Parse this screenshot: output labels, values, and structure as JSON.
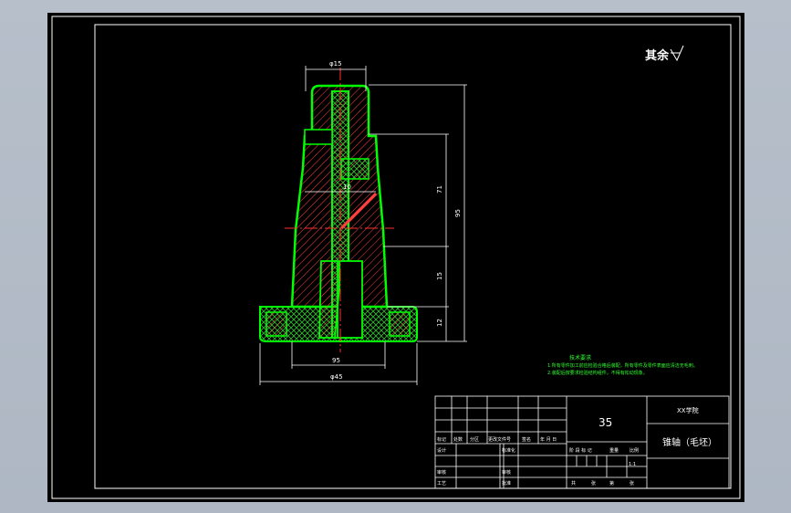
{
  "roughness_note": "其余",
  "dimensions": {
    "top_diameter": "φ15",
    "middle_diameter": "10",
    "bottom_inner": "95",
    "base_diameter": "φ45",
    "height_71": "71",
    "height_95": "95",
    "height_15": "15",
    "height_12": "12"
  },
  "tech_requirements": {
    "title": "技术要求",
    "line1": "1.所有零件加工前应检验合格后装配，所有零件及零件表面应清洁无毛刺。",
    "line2": "2.装配后按要求检验结构组件，不得有松动现象。"
  },
  "title_block": {
    "material": "35",
    "school": "XX学院",
    "part_name": "锥轴（毛坯）",
    "scale": "1:1",
    "headers_row": [
      "标记",
      "处数",
      "分区",
      "更改文件号",
      "签名",
      "年 月 日"
    ],
    "left_labels": [
      "设计",
      "审核",
      "工艺"
    ],
    "mid_labels": [
      "标准化",
      "审核",
      "批准"
    ],
    "stage_labels": [
      "阶 段 标 记",
      "重量",
      "比例"
    ],
    "sheet_labels": [
      "共",
      "张",
      "第",
      "张"
    ]
  },
  "colors": {
    "outline": "#ffffff",
    "part_line": "#00ff00",
    "hatch": "#ff5050",
    "dim": "#ffffff",
    "center": "#ff3030",
    "note_text": "#30ff30",
    "title_text": "#ffffff"
  }
}
